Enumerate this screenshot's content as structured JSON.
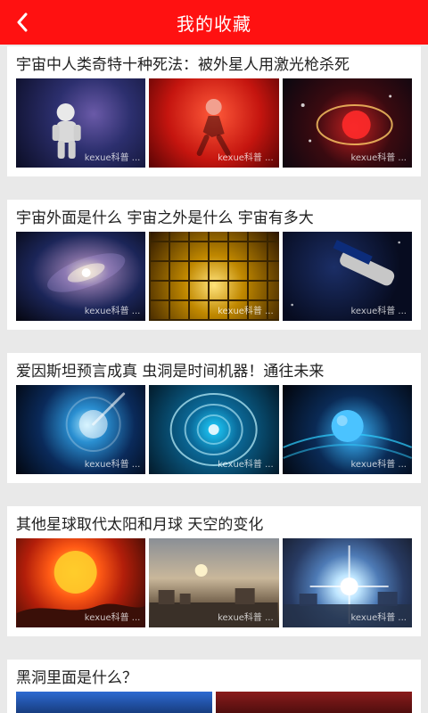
{
  "header": {
    "title": "我的收藏",
    "back_icon": "back-chevron-icon"
  },
  "articles": [
    {
      "title": "宇宙中人类奇特十种死法：被外星人用激光枪杀死",
      "watermark": "kexue科普 ..."
    },
    {
      "title": "宇宙外面是什么 宇宙之外是什么 宇宙有多大",
      "watermark": "kexue科普 ..."
    },
    {
      "title": "爱因斯坦预言成真 虫洞是时间机器！通往未来",
      "watermark": "kexue科普 ..."
    },
    {
      "title": "其他星球取代太阳和月球 天空的变化",
      "watermark": "kexue科普 ..."
    },
    {
      "title": "黑洞里面是什么？"
    }
  ],
  "colors": {
    "header_bg": "#ff1111",
    "page_bg": "#e9e9e9"
  }
}
